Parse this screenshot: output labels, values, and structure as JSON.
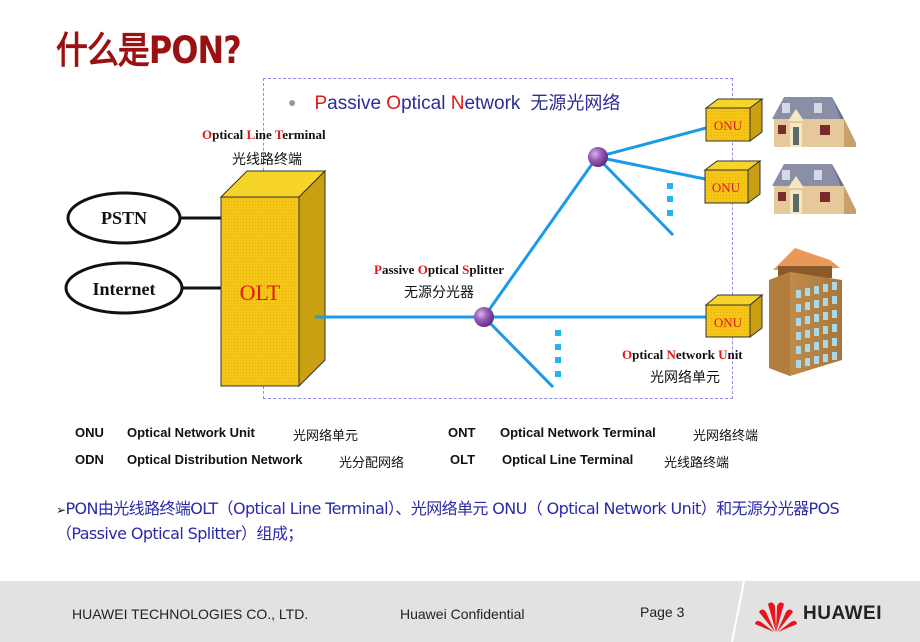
{
  "slide": {
    "title": "什么是PON?",
    "heading": {
      "parts": [
        {
          "text": "P",
          "accent": true
        },
        {
          "text": "assive ",
          "accent": false
        },
        {
          "text": "O",
          "accent": true
        },
        {
          "text": "ptical ",
          "accent": false
        },
        {
          "text": "N",
          "accent": true
        },
        {
          "text": "etwork",
          "accent": false
        }
      ],
      "cn": "无源光网络"
    },
    "colors": {
      "title": "#9b1010",
      "accent": "#e01818",
      "heading": "#2b2b99",
      "fiber": "#1a9be8",
      "device": "#f5c518",
      "summary": "#2a2aa8",
      "box_border": "#8f8ff0"
    }
  },
  "diagram": {
    "clouds": [
      {
        "label": "PSTN"
      },
      {
        "label": "Internet"
      }
    ],
    "olt": {
      "device_label": "OLT",
      "en_parts": [
        {
          "text": "O",
          "accent": true
        },
        {
          "text": "ptical ",
          "accent": false
        },
        {
          "text": "L",
          "accent": true
        },
        {
          "text": "ine ",
          "accent": false
        },
        {
          "text": "T",
          "accent": true
        },
        {
          "text": "erminal",
          "accent": false
        }
      ],
      "cn": "光线路终端"
    },
    "splitter": {
      "en_parts": [
        {
          "text": "P",
          "accent": true
        },
        {
          "text": "assive ",
          "accent": false
        },
        {
          "text": "O",
          "accent": true
        },
        {
          "text": "ptical ",
          "accent": false
        },
        {
          "text": "S",
          "accent": true
        },
        {
          "text": "plitter",
          "accent": false
        }
      ],
      "cn": "无源分光器"
    },
    "onu": {
      "device_label": "ONU",
      "en_parts": [
        {
          "text": "O",
          "accent": true
        },
        {
          "text": "ptical ",
          "accent": false
        },
        {
          "text": "N",
          "accent": true
        },
        {
          "text": "etwork ",
          "accent": false
        },
        {
          "text": "U",
          "accent": true
        },
        {
          "text": "nit",
          "accent": false
        }
      ],
      "cn": "光网络单元"
    },
    "onu_units": [
      {
        "label": "ONU",
        "premise": "house-icon"
      },
      {
        "label": "ONU",
        "premise": "house-icon"
      },
      {
        "label": "ONU",
        "premise": "office-building-icon"
      }
    ]
  },
  "glossary": [
    {
      "abbr": "ONU",
      "full": "Optical Network Unit",
      "cn": "光网络单元"
    },
    {
      "abbr": "ONT",
      "full": "Optical Network Terminal",
      "cn": "光网络终端"
    },
    {
      "abbr": "ODN",
      "full": "Optical Distribution Network",
      "cn": "光分配网络"
    },
    {
      "abbr": "OLT",
      "full": "Optical Line Terminal",
      "cn": "光线路终端"
    }
  ],
  "summary": {
    "bullet": "➢",
    "text": "PON由光线路终端OLT（Optical Line Terminal）、光网络单元 ONU（ Optical Network Unit）和无源分光器POS（Passive Optical Splitter）组成；"
  },
  "footer": {
    "company": "HUAWEI TECHNOLOGIES CO., LTD.",
    "confidential": "Huawei Confidential",
    "page": "Page 3",
    "brand": "HUAWEI"
  }
}
